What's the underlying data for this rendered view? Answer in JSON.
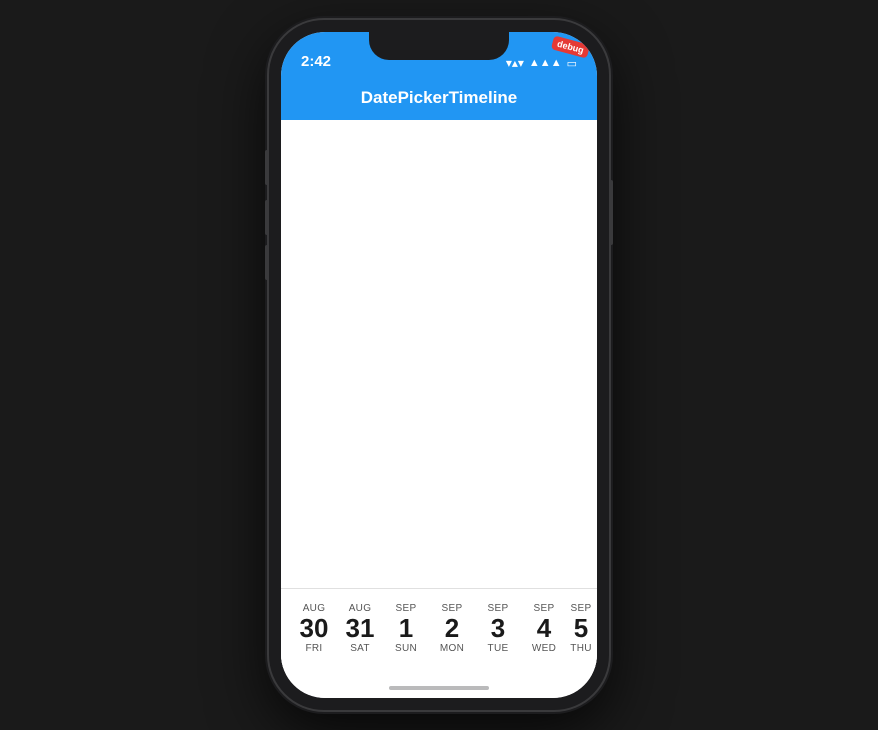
{
  "phone": {
    "status": {
      "time": "2:42",
      "wifi": "wifi",
      "battery": "battery"
    },
    "debug_label": "debug",
    "nav": {
      "title": "DatePickerTimeline"
    },
    "dates": [
      {
        "month": "AUG",
        "number": "30",
        "day": "FRI"
      },
      {
        "month": "AUG",
        "number": "31",
        "day": "SAT"
      },
      {
        "month": "SEP",
        "number": "1",
        "day": "SUN"
      },
      {
        "month": "SEP",
        "number": "2",
        "day": "MON"
      },
      {
        "month": "SEP",
        "number": "3",
        "day": "TUE"
      },
      {
        "month": "SEP",
        "number": "4",
        "day": "WED"
      },
      {
        "month": "SEP",
        "number": "5",
        "day": "THU"
      }
    ],
    "colors": {
      "accent": "#2196F3",
      "statusBar": "#2196F3",
      "navBar": "#2196F3"
    }
  }
}
